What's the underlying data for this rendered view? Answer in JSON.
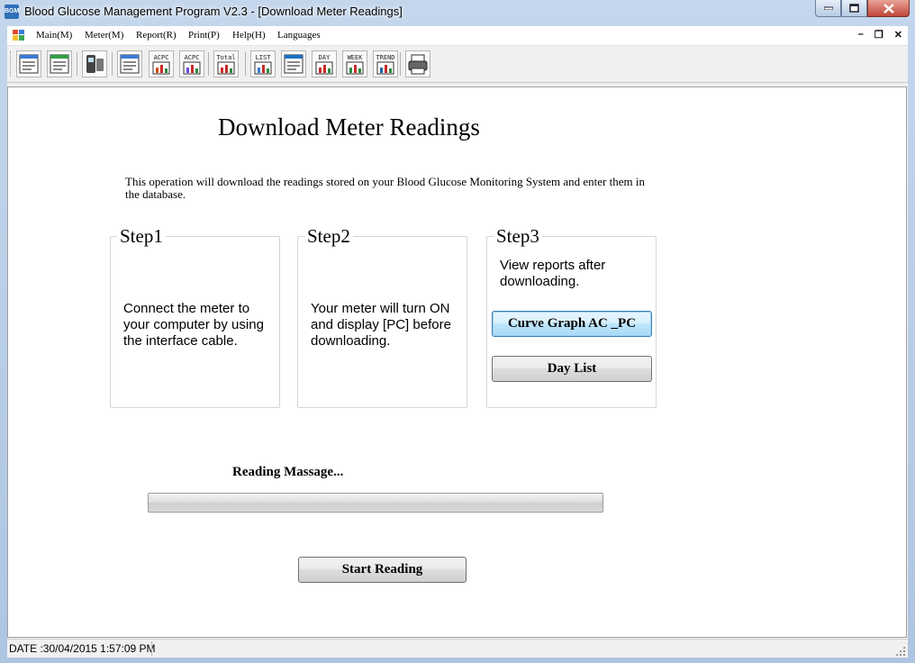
{
  "window": {
    "app_icon": "BGM",
    "title": "Blood Glucose Management Program V2.3 - [Download Meter Readings]"
  },
  "menu": {
    "items": [
      "Main(M)",
      "Meter(M)",
      "Report(R)",
      "Print(P)",
      "Help(H)",
      "Languages"
    ],
    "mdi_controls": [
      "–",
      "❐",
      "✕"
    ]
  },
  "toolbar": {
    "buttons": [
      {
        "name": "open-window-icon",
        "label": ""
      },
      {
        "name": "edit-data-icon",
        "label": ""
      },
      {
        "name": "meter-download-icon",
        "label": ""
      },
      {
        "name": "logbook-icon",
        "label": ""
      },
      {
        "name": "acpc-chart-icon",
        "label": "ACPC"
      },
      {
        "name": "acpc-curve-icon",
        "label": "ACPC"
      },
      {
        "name": "total-report-icon",
        "label": "Total"
      },
      {
        "name": "list-report-icon",
        "label": "LIST"
      },
      {
        "name": "chart-report-icon",
        "label": ""
      },
      {
        "name": "day-report-icon",
        "label": "DAY"
      },
      {
        "name": "week-report-icon",
        "label": "WEEK"
      },
      {
        "name": "trend-report-icon",
        "label": "TREND"
      },
      {
        "name": "printer-icon",
        "label": ""
      }
    ]
  },
  "page": {
    "heading": "Download Meter Readings",
    "intro": "This operation will download the readings stored on your Blood Glucose Monitoring System and enter them in the database."
  },
  "steps": [
    {
      "title": "Step1",
      "text": "Connect the meter to your computer by using the interface cable."
    },
    {
      "title": "Step2",
      "text": "Your meter will turn ON and display [PC] before downloading."
    },
    {
      "title": "Step3",
      "text": "View reports after downloading."
    }
  ],
  "step3_buttons": {
    "curve": "Curve Graph AC _PC",
    "daylist": "Day List"
  },
  "reading": {
    "message": "Reading Massage...",
    "progress": 0
  },
  "start_button": "Start Reading",
  "status": {
    "date": "DATE :30/04/2015 1:57:09 PM"
  },
  "colors": {
    "progress_fill": "#06b025",
    "focus_border": "#3c7fb1"
  }
}
